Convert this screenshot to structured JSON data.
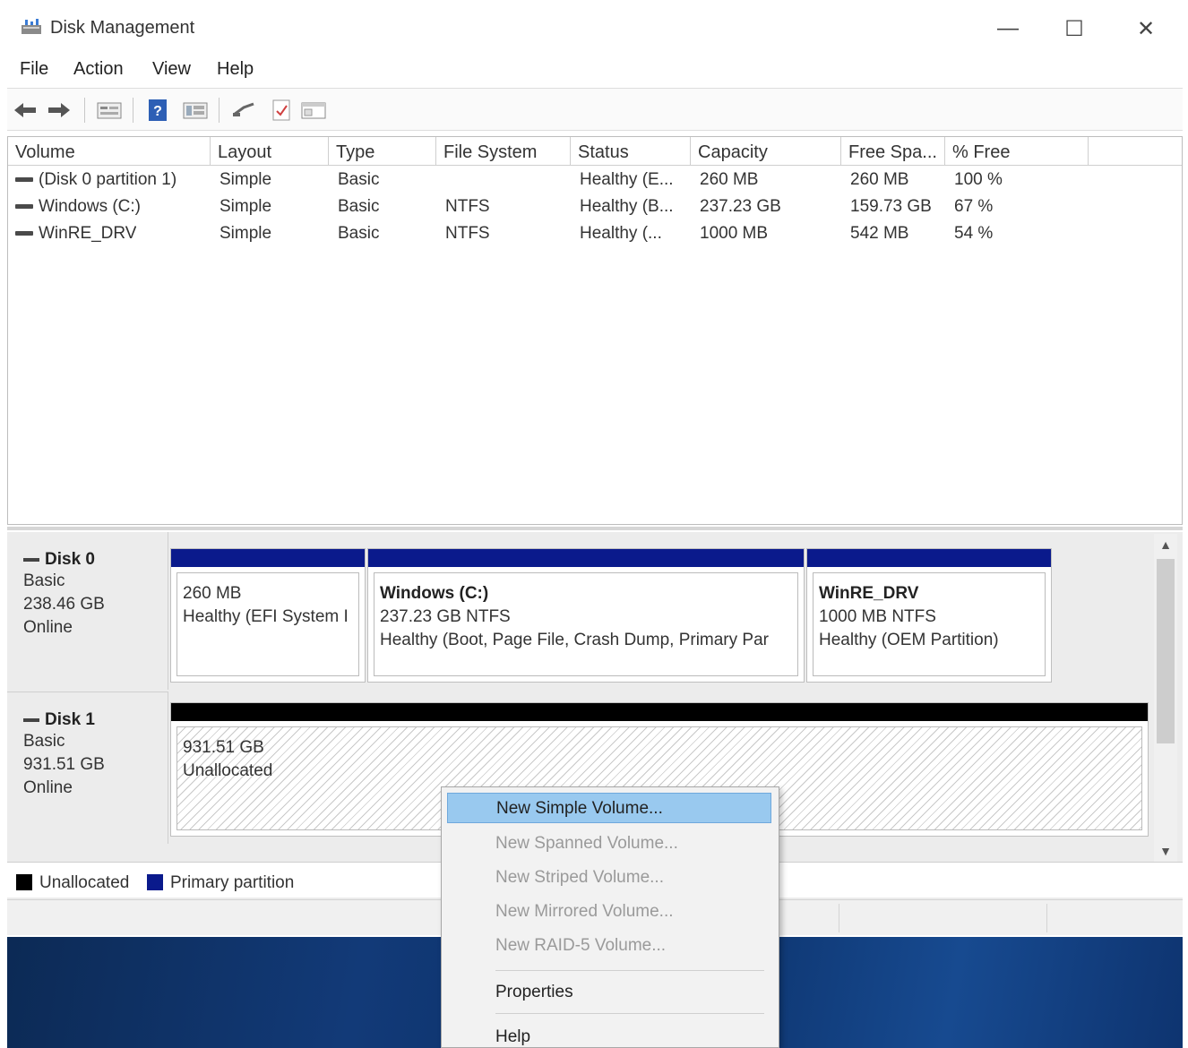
{
  "window": {
    "title": "Disk Management",
    "minimize_glyph": "—",
    "maximize_glyph": "☐",
    "close_glyph": "✕"
  },
  "menu": {
    "items": [
      "File",
      "Action",
      "View",
      "Help"
    ]
  },
  "toolbar": {
    "icons": [
      "back-icon",
      "forward-icon",
      "properties-icon",
      "help-icon",
      "view-icon",
      "connect-icon",
      "check-icon",
      "console-icon"
    ]
  },
  "volume_list": {
    "columns": [
      "Volume",
      "Layout",
      "Type",
      "File System",
      "Status",
      "Capacity",
      "Free Spa...",
      "% Free"
    ],
    "rows": [
      [
        "(Disk 0 partition 1)",
        "Simple",
        "Basic",
        "",
        "Healthy (E...",
        "260 MB",
        "260 MB",
        "100 %"
      ],
      [
        "Windows (C:)",
        "Simple",
        "Basic",
        "NTFS",
        "Healthy (B...",
        "237.23 GB",
        "159.73 GB",
        "67 %"
      ],
      [
        "WinRE_DRV",
        "Simple",
        "Basic",
        "NTFS",
        "Healthy (...",
        "1000 MB",
        "542 MB",
        "54 %"
      ]
    ]
  },
  "disks": [
    {
      "name": "Disk 0",
      "type": "Basic",
      "size": "238.46 GB",
      "state": "Online",
      "partitions": [
        {
          "title": "",
          "size": "260 MB",
          "status": "Healthy (EFI System I"
        },
        {
          "title": "Windows  (C:)",
          "size": "237.23 GB NTFS",
          "status": "Healthy (Boot, Page File, Crash Dump, Primary Par"
        },
        {
          "title": "WinRE_DRV",
          "size": "1000 MB NTFS",
          "status": "Healthy (OEM Partition)"
        }
      ]
    },
    {
      "name": "Disk 1",
      "type": "Basic",
      "size": "931.51 GB",
      "state": "Online",
      "partitions": [
        {
          "title": "",
          "size": "931.51 GB",
          "status": "Unallocated"
        }
      ]
    }
  ],
  "legend": {
    "unallocated": "Unallocated",
    "primary": "Primary partition"
  },
  "context_menu": {
    "items": [
      {
        "label": "New Simple Volume...",
        "state": "highlighted"
      },
      {
        "label": "New Spanned Volume...",
        "state": "disabled"
      },
      {
        "label": "New Striped Volume...",
        "state": "disabled"
      },
      {
        "label": "New Mirrored Volume...",
        "state": "disabled"
      },
      {
        "label": "New RAID-5 Volume...",
        "state": "disabled"
      },
      {
        "label": "Properties",
        "state": "enabled"
      },
      {
        "label": "Help",
        "state": "enabled"
      }
    ]
  },
  "colors": {
    "primary_partition": "#0a1a8c",
    "unallocated": "#000000",
    "menu_highlight": "#99c9ef"
  }
}
